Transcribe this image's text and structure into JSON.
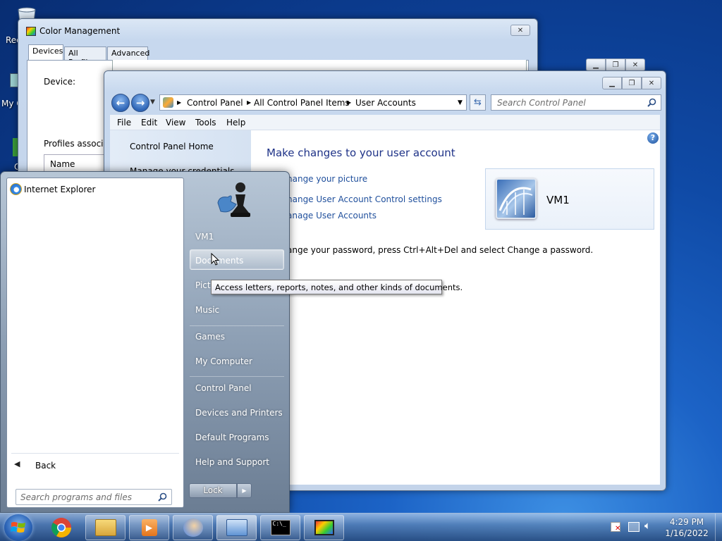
{
  "desktop": {
    "recycle_label": "Rec",
    "computer_label": "My C",
    "third_label": "C"
  },
  "color_mgmt": {
    "title": "Color Management",
    "tabs": [
      "Devices",
      "All Profiles",
      "Advanced"
    ],
    "device_label": "Device:",
    "profiles_label": "Profiles associat",
    "name_header": "Name"
  },
  "control_panel": {
    "breadcrumb": [
      "Control Panel",
      "All Control Panel Items",
      "User Accounts"
    ],
    "search_placeholder": "Search Control Panel",
    "menu": [
      "File",
      "Edit",
      "View",
      "Tools",
      "Help"
    ],
    "left_links": [
      "Control Panel Home",
      "Manage your credentials"
    ],
    "heading": "Make changes to your user account",
    "links": [
      "hange your picture",
      "hange User Account Control settings",
      "anage User Accounts"
    ],
    "password_text": "ange your password, press Ctrl+Alt+Del and select Change a password.",
    "user_name": "VM1"
  },
  "start_menu": {
    "programs": [
      {
        "label": "Internet Explorer",
        "icon": "internet-explorer-icon"
      }
    ],
    "back_label": "Back",
    "search_placeholder": "Search programs and files",
    "right_items": [
      "VM1",
      "Documents",
      "Pict",
      "Music",
      "Games",
      "My Computer",
      "Control Panel",
      "Devices and Printers",
      "Default Programs",
      "Help and Support"
    ],
    "lock_label": "Lock",
    "tooltip": "Access letters, reports, notes, and other kinds of documents."
  },
  "taskbar": {
    "apps": [
      "file-explorer-icon",
      "media-player-icon",
      "user-accounts-icon",
      "control-panel-icon",
      "command-prompt-icon",
      "color-management-icon"
    ],
    "time": "4:29 PM",
    "date": "1/16/2022"
  },
  "colors": {
    "link": "#1f4f9c",
    "heading": "#1e3287"
  }
}
